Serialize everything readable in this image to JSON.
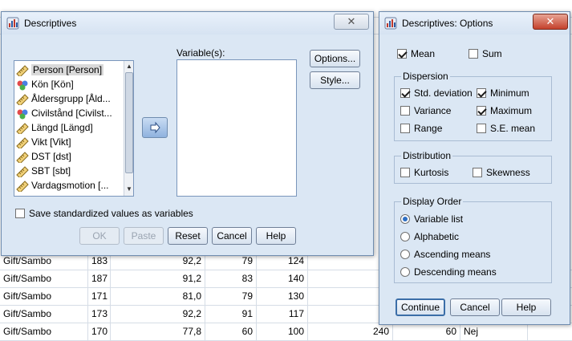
{
  "spreadsheet": {
    "rows": [
      {
        "c1": "Gift/Sambo",
        "c2": "183",
        "c3": "92,2",
        "c4": "79",
        "c5": "124"
      },
      {
        "c1": "Gift/Sambo",
        "c2": "187",
        "c3": "91,2",
        "c4": "83",
        "c5": "140"
      },
      {
        "c1": "Gift/Sambo",
        "c2": "171",
        "c3": "81,0",
        "c4": "79",
        "c5": "130"
      },
      {
        "c1": "Gift/Sambo",
        "c2": "173",
        "c3": "92,2",
        "c4": "91",
        "c5": "117"
      },
      {
        "c1": "Gift/Sambo",
        "c2": "170",
        "c3": "77,8",
        "c4": "60",
        "c5": "100"
      }
    ],
    "partial_right": {
      "a": "240",
      "b": "60",
      "c": "Nej"
    }
  },
  "descriptives": {
    "title": "Descriptives",
    "close": "✕",
    "variable_label": "Variable(s):",
    "variables": [
      {
        "label": "Person [Person]",
        "icon": "ruler-icon"
      },
      {
        "label": "Kön [Kön]",
        "icon": "nominal-icon"
      },
      {
        "label": "Åldersgrupp [Åld...",
        "icon": "ruler-icon"
      },
      {
        "label": "Civilstånd [Civilst...",
        "icon": "nominal-icon"
      },
      {
        "label": "Längd [Längd]",
        "icon": "ruler-icon"
      },
      {
        "label": "Vikt [Vikt]",
        "icon": "ruler-icon"
      },
      {
        "label": "DST [dst]",
        "icon": "ruler-icon"
      },
      {
        "label": "SBT [sbt]",
        "icon": "ruler-icon"
      },
      {
        "label": "Vardagsmotion [...",
        "icon": "ruler-icon"
      }
    ],
    "options_btn": "Options...",
    "style_btn": "Style...",
    "save_std": "Save standardized values as variables",
    "ok": "OK",
    "paste": "Paste",
    "reset": "Reset",
    "cancel": "Cancel",
    "help": "Help"
  },
  "options": {
    "title": "Descriptives: Options",
    "close": "✕",
    "mean": {
      "label": "Mean",
      "checked": true
    },
    "sum": {
      "label": "Sum",
      "checked": false
    },
    "dispersion_label": "Dispersion",
    "std": {
      "label": "Std. deviation",
      "checked": true
    },
    "minimum": {
      "label": "Minimum",
      "checked": true
    },
    "variance": {
      "label": "Variance",
      "checked": false
    },
    "maximum": {
      "label": "Maximum",
      "checked": true
    },
    "range": {
      "label": "Range",
      "checked": false
    },
    "se_mean": {
      "label": "S.E. mean",
      "checked": false
    },
    "distribution_label": "Distribution",
    "kurtosis": {
      "label": "Kurtosis",
      "checked": false
    },
    "skewness": {
      "label": "Skewness",
      "checked": false
    },
    "display_order_label": "Display Order",
    "orders": [
      {
        "label": "Variable list",
        "selected": true
      },
      {
        "label": "Alphabetic",
        "selected": false
      },
      {
        "label": "Ascending means",
        "selected": false
      },
      {
        "label": "Descending means",
        "selected": false
      }
    ],
    "continue": "Continue",
    "cancel": "Cancel",
    "help": "Help"
  }
}
